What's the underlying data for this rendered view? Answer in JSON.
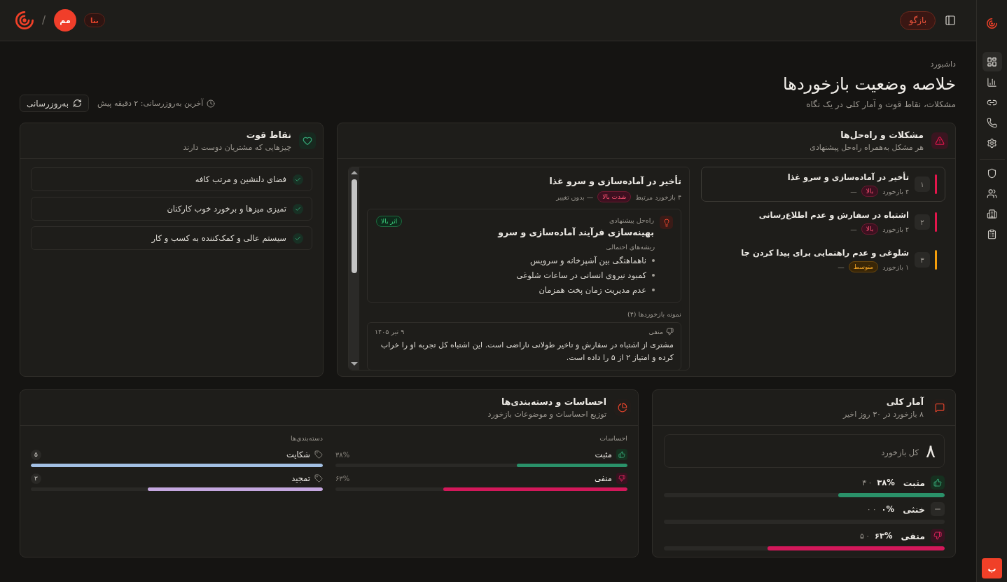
{
  "header": {
    "back_button": "بازگو",
    "beta_badge": "بتا",
    "avatar_initials": "مم",
    "separator": "/"
  },
  "sidebar": {
    "groups": [
      {
        "items": [
          {
            "selected": true
          },
          {
            "selected": false
          },
          {
            "selected": false
          },
          {
            "selected": false
          },
          {
            "selected": false
          }
        ]
      },
      {
        "items": [
          {
            "selected": false
          },
          {
            "selected": false
          },
          {
            "selected": false
          },
          {
            "selected": false
          }
        ]
      }
    ],
    "user_button": "ب"
  },
  "page": {
    "breadcrumb": "داشبورد",
    "title": "خلاصه وضعیت بازخوردها",
    "subtitle": "مشکلات، نقاط قوت و آمار کلی در یک نگاه",
    "last_updated": "آخرین به‌روزرسانی: ۲ دقیقه پیش",
    "refresh_button": "به‌روزرسانی"
  },
  "problems": {
    "title": "مشکلات و راه‌حل‌ها",
    "subtitle": "هر مشکل به‌همراه راه‌حل پیشنهادی",
    "items": [
      {
        "kind": "high",
        "number": "۱",
        "title": "تأخیر در آماده‌سازی و سرو غذا",
        "count": "۴ بازخورد",
        "severity_label": "بالا",
        "trend": "—",
        "selected": true
      },
      {
        "kind": "high",
        "number": "۲",
        "title": "اشتباه در سفارش و عدم اطلاع‌رسانی",
        "count": "۲ بازخورد",
        "severity_label": "بالا",
        "trend": "—",
        "selected": false
      },
      {
        "kind": "medium",
        "number": "۳",
        "title": "شلوغی و عدم راهنمایی برای پیدا کردن جا",
        "count": "۱ بازخورد",
        "severity_label": "متوسط",
        "trend": "—",
        "selected": false
      }
    ],
    "detail": {
      "kind": "high",
      "title": "تأخیر در آماده‌سازی و سرو غذا",
      "count": "۴ بازخورد مرتبط",
      "severity_label": "شدت بالا",
      "trend": "— بدون تغییر",
      "solution": {
        "kind": "high",
        "label": "راه‌حل پیشنهادی",
        "title": "بهینه‌سازی فرآیند آماده‌سازی و سرو",
        "impact_label": "اثر بالا",
        "causes_label": "ریشه‌های احتمالی",
        "causes": [
          "ناهماهنگی بین آشپزخانه و سرویس",
          "کمبود نیروی انسانی در ساعات شلوغی",
          "عدم مدیریت زمان پخت همزمان"
        ]
      },
      "samples_label": "نمونه بازخوردها (۴)",
      "samples": [
        {
          "kind": "negative",
          "sentiment_label": "منفی",
          "date": "۹ تیر ۱۴۰۵",
          "text": "مشتری از اشتباه در سفارش و تاخیر طولانی ناراضی است. این اشتباه کل تجربه او را خراب کرده و امتیاز ۲ از ۵ را داده است."
        }
      ]
    }
  },
  "strengths": {
    "title": "نقاط قوت",
    "subtitle": "چیزهایی که مشتریان دوست دارند",
    "items": [
      "فضای دلنشین و مرتب کافه",
      "تمیزی میزها و برخورد خوب کارکنان",
      "سیستم عالی و کمک‌کننده به کسب و کار"
    ]
  },
  "stats": {
    "title": "آمار کلی",
    "subtitle": "۸ بازخورد در ۳۰ روز اخیر",
    "total": "۸",
    "total_label": "کل بازخورد",
    "rows": [
      {
        "kind": "positive",
        "label": "مثبت",
        "percent": "۳۸%",
        "count": "· ۳",
        "level": 0.38
      },
      {
        "kind": "neutral",
        "label": "خنثی",
        "percent": "۰%",
        "count": "· ۰",
        "level": 0
      },
      {
        "kind": "negative",
        "label": "منفی",
        "percent": "۶۳%",
        "count": "· ۵",
        "level": 0.63
      }
    ]
  },
  "sentiment": {
    "title": "احساسات و دسته‌بندی‌ها",
    "subtitle": "توزیع احساسات و موضوعات بازخورد",
    "sentiments_label": "احساسات",
    "sentiments": [
      {
        "kind": "positive",
        "label": "مثبت",
        "percent": "۳۸%",
        "level": 0.38
      },
      {
        "kind": "negative",
        "label": "منفی",
        "percent": "۶۳%",
        "level": 0.63
      }
    ],
    "categories_label": "دسته‌بندی‌ها",
    "categories": [
      {
        "label": "شکایت",
        "count": "۵",
        "level": 1,
        "color": "#a3c0e4"
      },
      {
        "label": "تمجید",
        "count": "۳",
        "level": 0.6,
        "color": "#c4a7df"
      }
    ]
  }
}
